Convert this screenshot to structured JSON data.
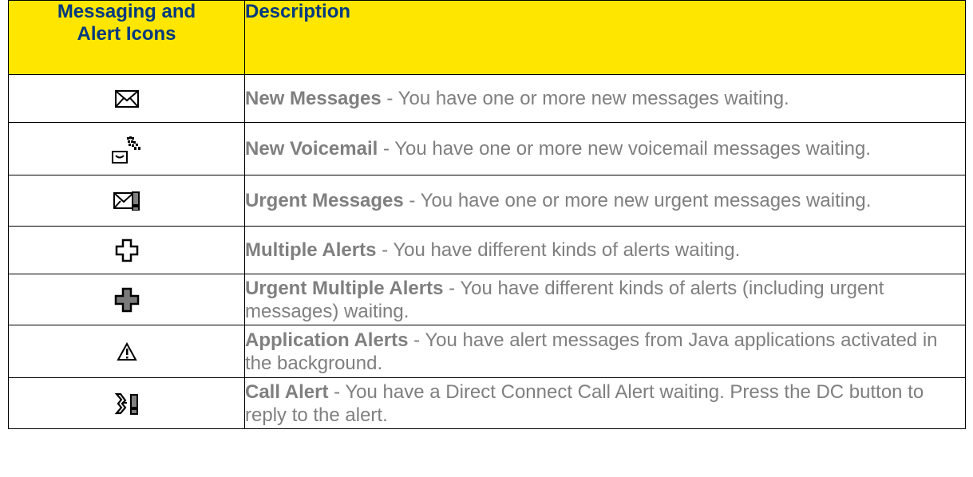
{
  "table": {
    "header": {
      "icons_line1": "Messaging and",
      "icons_line2": "Alert Icons",
      "description": "Description"
    },
    "rows": [
      {
        "icon": "envelope-icon",
        "title": "New Messages",
        "text": " - You have one or more new messages waiting."
      },
      {
        "icon": "voicemail-icon",
        "title": "New Voicemail",
        "text": " - You have one or more new voicemail messages waiting."
      },
      {
        "icon": "urgent-envelope-icon",
        "title": "Urgent Messages",
        "text": " - You have one or more new urgent messages waiting."
      },
      {
        "icon": "multiple-alerts-icon",
        "title": "Multiple Alerts",
        "text": " - You have different kinds of alerts waiting."
      },
      {
        "icon": "urgent-multiple-alerts-icon",
        "title": "Urgent Multiple Alerts",
        "text": " - You have different kinds of alerts (including urgent messages) waiting."
      },
      {
        "icon": "warning-icon",
        "title": "Application Alerts",
        "text": " - You have alert messages from Java applications activated in the background."
      },
      {
        "icon": "call-alert-icon",
        "title": "Call Alert",
        "text": " - You have a Direct Connect Call Alert waiting. Press the DC button to reply to the alert."
      }
    ]
  },
  "colors": {
    "header_bg": "#ffe600",
    "header_text": "#003880",
    "body_text": "#7f7f7f",
    "border": "#000000"
  }
}
